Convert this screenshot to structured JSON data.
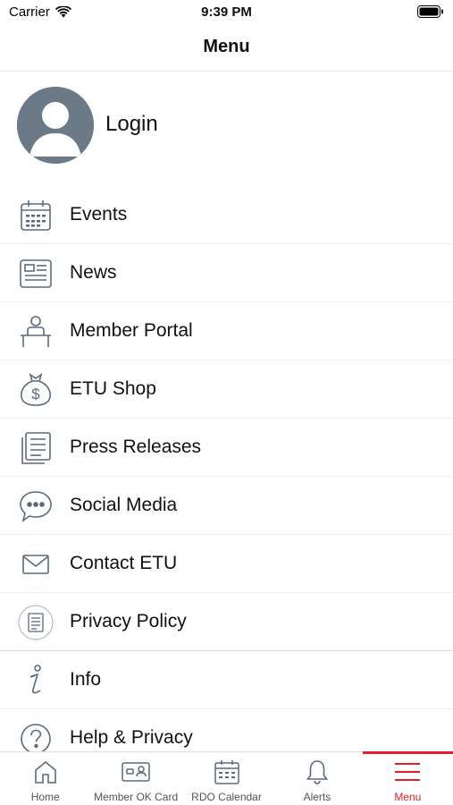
{
  "status_bar": {
    "carrier": "Carrier",
    "time": "9:39 PM"
  },
  "nav": {
    "title": "Menu"
  },
  "login": {
    "label": "Login"
  },
  "menu": {
    "items": [
      {
        "label": "Events",
        "icon": "calendar-icon"
      },
      {
        "label": "News",
        "icon": "newspaper-icon"
      },
      {
        "label": "Member Portal",
        "icon": "person-desk-icon"
      },
      {
        "label": "ETU Shop",
        "icon": "money-bag-icon"
      },
      {
        "label": "Press Releases",
        "icon": "documents-icon"
      },
      {
        "label": "Social Media",
        "icon": "chat-bubble-icon"
      },
      {
        "label": "Contact ETU",
        "icon": "envelope-icon"
      },
      {
        "label": "Privacy Policy",
        "icon": "privacy-policy-icon"
      },
      {
        "label": "Info",
        "icon": "info-icon"
      },
      {
        "label": "Help & Privacy",
        "icon": "question-icon"
      }
    ]
  },
  "tab_bar": {
    "tabs": [
      {
        "label": "Home",
        "icon": "home-icon"
      },
      {
        "label": "Member OK Card",
        "icon": "id-card-icon"
      },
      {
        "label": "RDO Calendar",
        "icon": "calendar-icon"
      },
      {
        "label": "Alerts",
        "icon": "bell-icon"
      },
      {
        "label": "Menu",
        "icon": "hamburger-icon",
        "active": true
      }
    ]
  },
  "colors": {
    "accent": "#e0202b",
    "icon": "#5b6a7a",
    "avatar": "#6c7987"
  }
}
